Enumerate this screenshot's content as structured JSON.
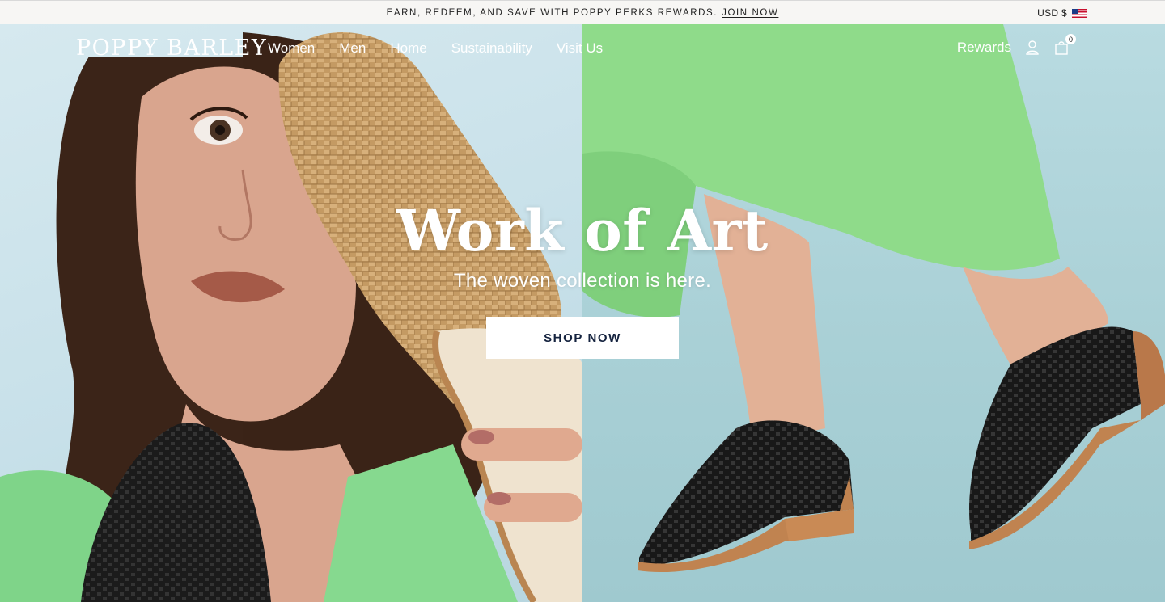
{
  "announcement": {
    "text": "EARN, REDEEM, AND SAVE WITH POPPY PERKS REWARDS.",
    "link_label": "JOIN NOW"
  },
  "currency": {
    "label": "USD $",
    "flag_icon": "us-flag-icon"
  },
  "header": {
    "logo": "POPPY BARLEY",
    "menu": [
      {
        "label": "Women"
      },
      {
        "label": "Men"
      },
      {
        "label": "Home"
      },
      {
        "label": "Sustainability"
      },
      {
        "label": "Visit Us"
      }
    ],
    "rewards_label": "Rewards",
    "account_icon": "user-icon",
    "cart_icon": "shopping-bag-icon",
    "cart_count": "0"
  },
  "hero": {
    "title": "Work of Art",
    "subtitle": "The woven collection is here.",
    "cta_label": "SHOP NOW",
    "colors": {
      "cta_text": "#15233f",
      "left_background": "#cfe4ec",
      "right_background": "#acd2d8",
      "dress_green": "#8fdb8a"
    }
  }
}
